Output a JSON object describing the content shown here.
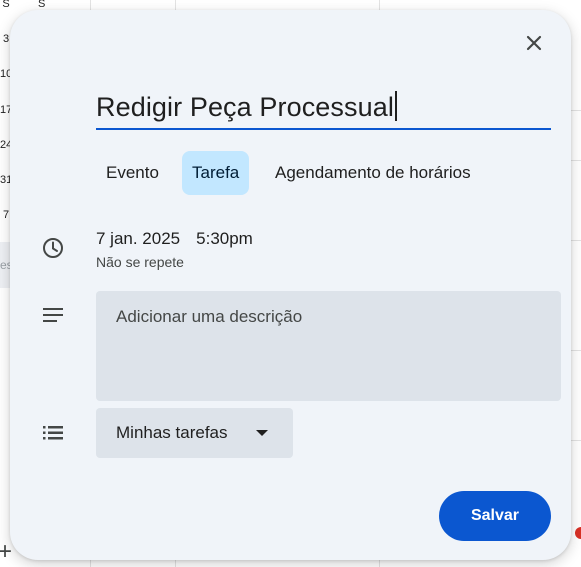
{
  "background": {
    "mini_calendar": {
      "header_day_1": "S",
      "header_day_2": "S",
      "dates": [
        "3",
        "10",
        "17",
        "24",
        "31",
        "7"
      ],
      "partial_text": "es"
    }
  },
  "dialog": {
    "close_icon": "close-icon",
    "title_value": "Redigir Peça Processual",
    "tabs": [
      {
        "label": "Evento",
        "active": false
      },
      {
        "label": "Tarefa",
        "active": true
      },
      {
        "label": "Agendamento de horários",
        "active": false
      }
    ],
    "date": "7 jan. 2025",
    "time": "5:30pm",
    "repeat": "Não se repete",
    "description_placeholder": "Adicionar uma descrição",
    "task_list": "Minhas tarefas",
    "save_label": "Salvar"
  },
  "colors": {
    "dialog_bg": "#f0f4f9",
    "accent": "#0b57d0",
    "active_tab_bg": "#c2e7ff",
    "input_bg": "#dde3ea"
  }
}
